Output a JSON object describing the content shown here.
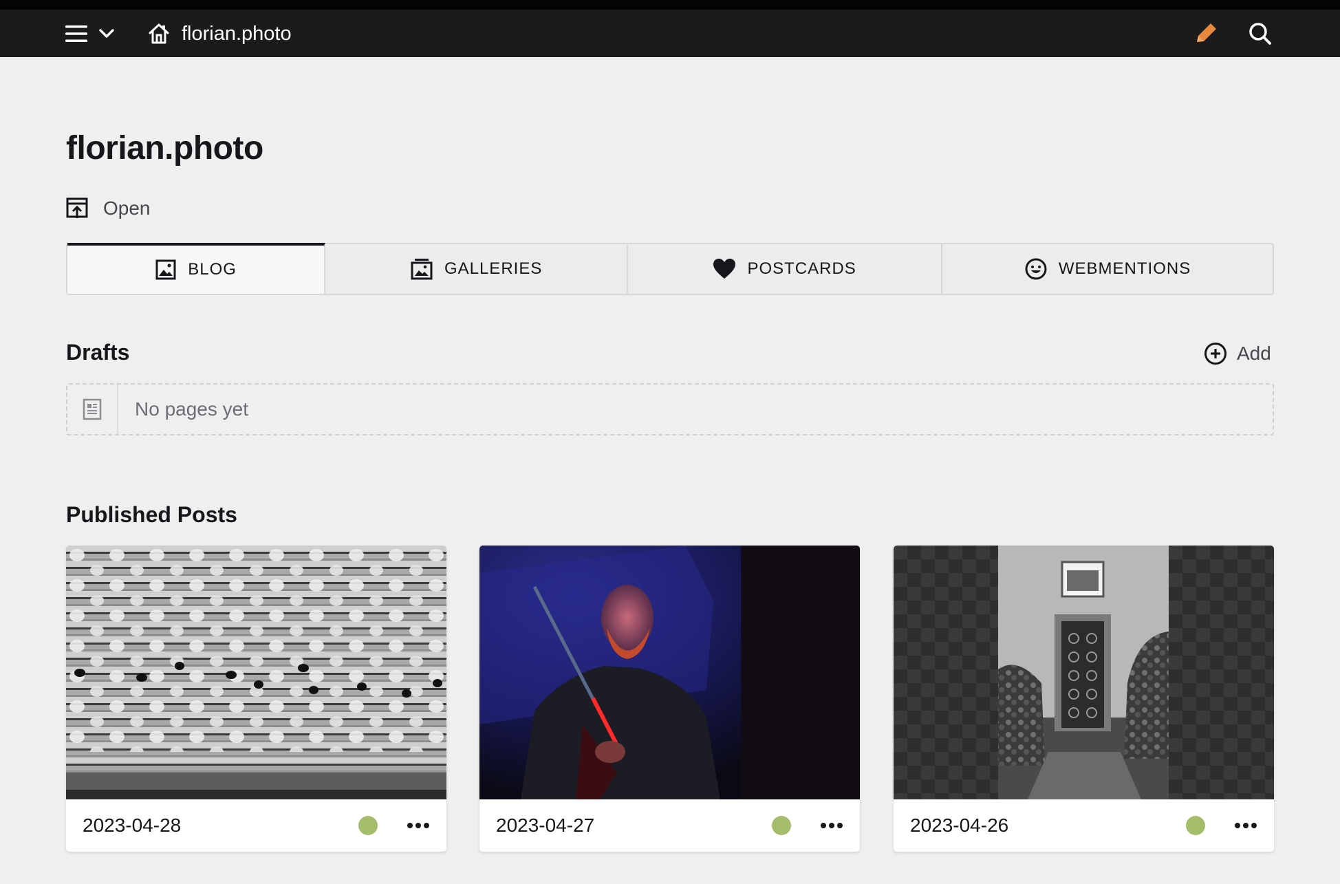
{
  "topbar": {
    "menu_icon": "hamburger-icon",
    "dropdown_icon": "chevron-down-icon",
    "home_icon": "home-icon",
    "home_label": "florian.photo",
    "edit_icon": "pencil-icon",
    "search_icon": "search-icon",
    "edit_color": "#e8883f"
  },
  "page": {
    "title": "florian.photo",
    "open_label": "Open",
    "open_icon": "open-external-icon"
  },
  "tabs": [
    {
      "label": "BLOG",
      "icon": "image-icon",
      "active": true
    },
    {
      "label": "GALLERIES",
      "icon": "gallery-icon",
      "active": false
    },
    {
      "label": "POSTCARDS",
      "icon": "heart-icon",
      "active": false
    },
    {
      "label": "WEBMENTIONS",
      "icon": "smiley-icon",
      "active": false
    }
  ],
  "drafts": {
    "title": "Drafts",
    "add_label": "Add",
    "add_icon": "plus-circle-icon",
    "empty_text": "No pages yet",
    "empty_icon": "page-icon"
  },
  "published": {
    "title": "Published Posts",
    "posts": [
      {
        "date": "2023-04-28",
        "status": "published",
        "status_color": "#a4bd6a",
        "thumb": "bw-stacked-pipes-photo"
      },
      {
        "date": "2023-04-27",
        "status": "published",
        "status_color": "#a4bd6a",
        "thumb": "man-with-light-saber-portrait"
      },
      {
        "date": "2023-04-26",
        "status": "published",
        "status_color": "#a4bd6a",
        "thumb": "bw-doorway-photo"
      }
    ]
  }
}
